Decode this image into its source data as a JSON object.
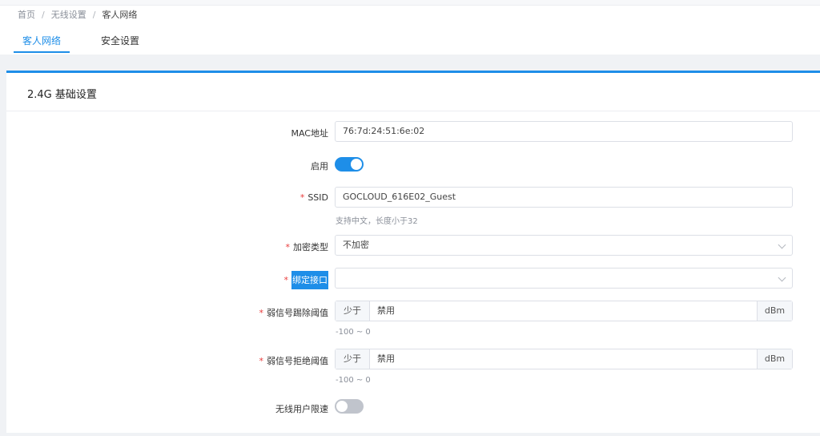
{
  "breadcrumb": {
    "items": [
      "首页",
      "无线设置",
      "客人网络"
    ],
    "separator": "/"
  },
  "tabs": [
    {
      "label": "客人网络",
      "active": true
    },
    {
      "label": "安全设置",
      "active": false
    }
  ],
  "panel": {
    "title": "2.4G 基础设置"
  },
  "form": {
    "mac": {
      "label": "MAC地址",
      "value": "76:7d:24:51:6e:02"
    },
    "enable": {
      "label": "启用",
      "on": true
    },
    "ssid": {
      "label": "SSID",
      "required_mark": "*",
      "value": "GOCLOUD_616E02_Guest",
      "hint": "支持中文，长度小于32"
    },
    "encryption": {
      "label": "加密类型",
      "required_mark": "*",
      "value": "不加密"
    },
    "bind_interface": {
      "label": "绑定接口",
      "required_mark": "*",
      "value": ""
    },
    "weak_kick": {
      "label": "弱信号踢除阈值",
      "required_mark": "*",
      "prefix": "少于",
      "value": "禁用",
      "suffix": "dBm",
      "hint": "-100 ~ 0"
    },
    "weak_reject": {
      "label": "弱信号拒绝阈值",
      "required_mark": "*",
      "prefix": "少于",
      "value": "禁用",
      "suffix": "dBm",
      "hint": "-100 ~ 0"
    },
    "rate_limit": {
      "label": "无线用户限速",
      "on": false
    }
  },
  "colors": {
    "accent": "#1e8ee8",
    "toggle_off": "#c0c4cc",
    "required": "#e83b3b"
  }
}
